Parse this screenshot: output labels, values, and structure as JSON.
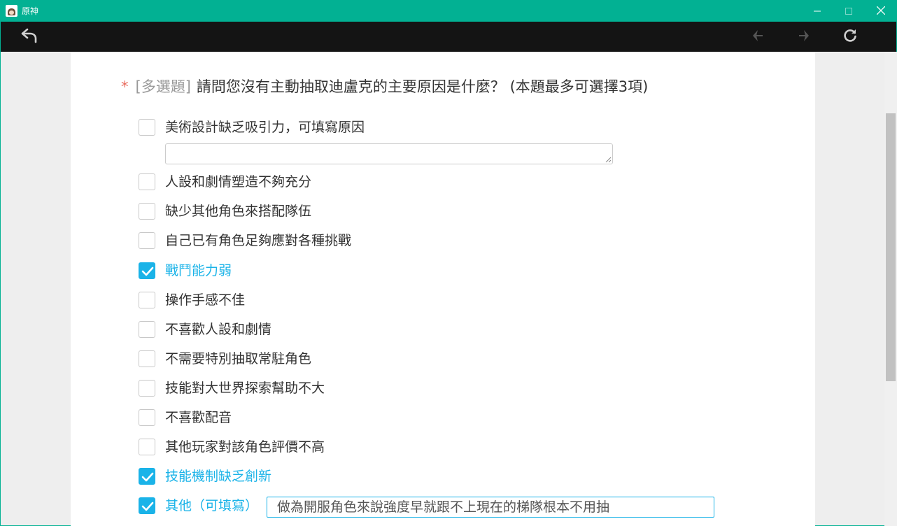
{
  "window": {
    "title": "原神",
    "app_icon": "genshin-app-icon",
    "controls": [
      "minimize-icon",
      "maximize-icon",
      "close-icon"
    ]
  },
  "toolbar": {
    "back_icon": "back-arrow-icon",
    "prev_icon": "prev-diamond-arrow-icon",
    "next_icon": "next-diamond-arrow-icon",
    "reload_icon": "reload-icon"
  },
  "question": {
    "required_mark": "*",
    "type_tag": "[多選題]",
    "text": "請問您沒有主動抽取迪盧克的主要原因是什麼？ (本題最多可選擇3項)"
  },
  "options": [
    {
      "label": "美術設計缺乏吸引力，可填寫原因",
      "checked": false
    },
    {
      "label": "人設和劇情塑造不夠充分",
      "checked": false
    },
    {
      "label": "缺少其他角色來搭配隊伍",
      "checked": false
    },
    {
      "label": "自己已有角色足夠應對各種挑戰",
      "checked": false
    },
    {
      "label": "戰鬥能力弱",
      "checked": true
    },
    {
      "label": "操作手感不佳",
      "checked": false
    },
    {
      "label": "不喜歡人設和劇情",
      "checked": false
    },
    {
      "label": "不需要特別抽取常駐角色",
      "checked": false
    },
    {
      "label": "技能對大世界探索幫助不大",
      "checked": false
    },
    {
      "label": "不喜歡配音",
      "checked": false
    },
    {
      "label": "其他玩家對該角色評價不高",
      "checked": false
    },
    {
      "label": "技能機制缺乏創新",
      "checked": true
    },
    {
      "label": "其他（可填寫）",
      "checked": true
    }
  ],
  "reason_textarea": {
    "value": ""
  },
  "other_input": {
    "value": "做為開服角色來說強度早就跟不上現在的梯隊根本不用抽"
  },
  "colors": {
    "titlebar": "#02b193",
    "toolbar": "#141414",
    "accent": "#1ab3e8",
    "required": "#e86a5d"
  }
}
